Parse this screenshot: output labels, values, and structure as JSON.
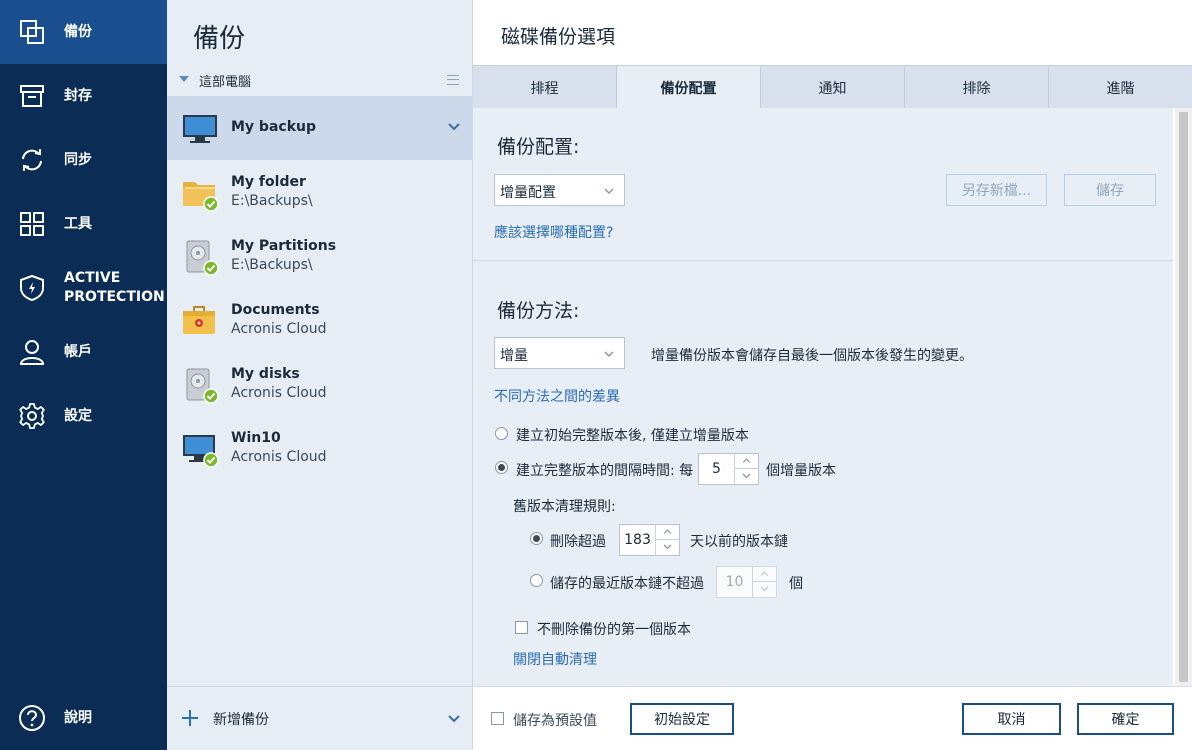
{
  "nav": {
    "items": [
      {
        "label": "備份",
        "icon": "copy-icon"
      },
      {
        "label": "封存",
        "icon": "archive-icon"
      },
      {
        "label": "同步",
        "icon": "sync-icon"
      },
      {
        "label": "工具",
        "icon": "tools-grid-icon"
      },
      {
        "label": "ACTIVE PROTECTION",
        "icon": "shield-icon"
      },
      {
        "label": "帳戶",
        "icon": "user-icon"
      },
      {
        "label": "設定",
        "icon": "gear-icon"
      }
    ],
    "help": "說明"
  },
  "list": {
    "title": "備份",
    "section": "這部電腦",
    "items": [
      {
        "name": "My backup",
        "sub": ""
      },
      {
        "name": "My folder",
        "sub": "E:\\Backups\\"
      },
      {
        "name": "My Partitions",
        "sub": "E:\\Backups\\"
      },
      {
        "name": "Documents",
        "sub": "Acronis Cloud"
      },
      {
        "name": "My disks",
        "sub": "Acronis Cloud"
      },
      {
        "name": "Win10",
        "sub": "Acronis Cloud"
      }
    ],
    "add": "新增備份"
  },
  "dialog": {
    "title": "磁碟備份選項",
    "tabs": [
      "排程",
      "備份配置",
      "通知",
      "排除",
      "進階"
    ],
    "scheme": {
      "title": "備份配置:",
      "selected": "增量配置",
      "save_as": "另存新檔...",
      "save": "儲存",
      "link": "應該選擇哪種配置?"
    },
    "method": {
      "title": "備份方法:",
      "selected": "增量",
      "description": "增量備份版本會儲存自最後一個版本後發生的變更。",
      "link": "不同方法之間的差異",
      "option1": "建立初始完整版本後, 僅建立增量版本",
      "option2_prefix": "建立完整版本的間隔時間: 每",
      "option2_value": "5",
      "option2_suffix": "個增量版本",
      "cleanup_title": "舊版本清理規則:",
      "rule1_prefix": "刪除超過",
      "rule1_value": "183",
      "rule1_suffix": "天以前的版本鏈",
      "rule2_prefix": "儲存的最近版本鏈不超過",
      "rule2_value": "10",
      "rule2_suffix": "個",
      "keep_first": "不刪除備份的第一個版本",
      "disable_cleanup": "關閉自動清理"
    },
    "footer": {
      "save_default": "儲存為預設值",
      "reset": "初始設定",
      "cancel": "取消",
      "ok": "確定"
    }
  },
  "colors": {
    "nav_bg": "#0a2c55",
    "nav_active": "#1a4f8f",
    "accent": "#2a6cb5",
    "ok_badge": "#7cb928"
  }
}
